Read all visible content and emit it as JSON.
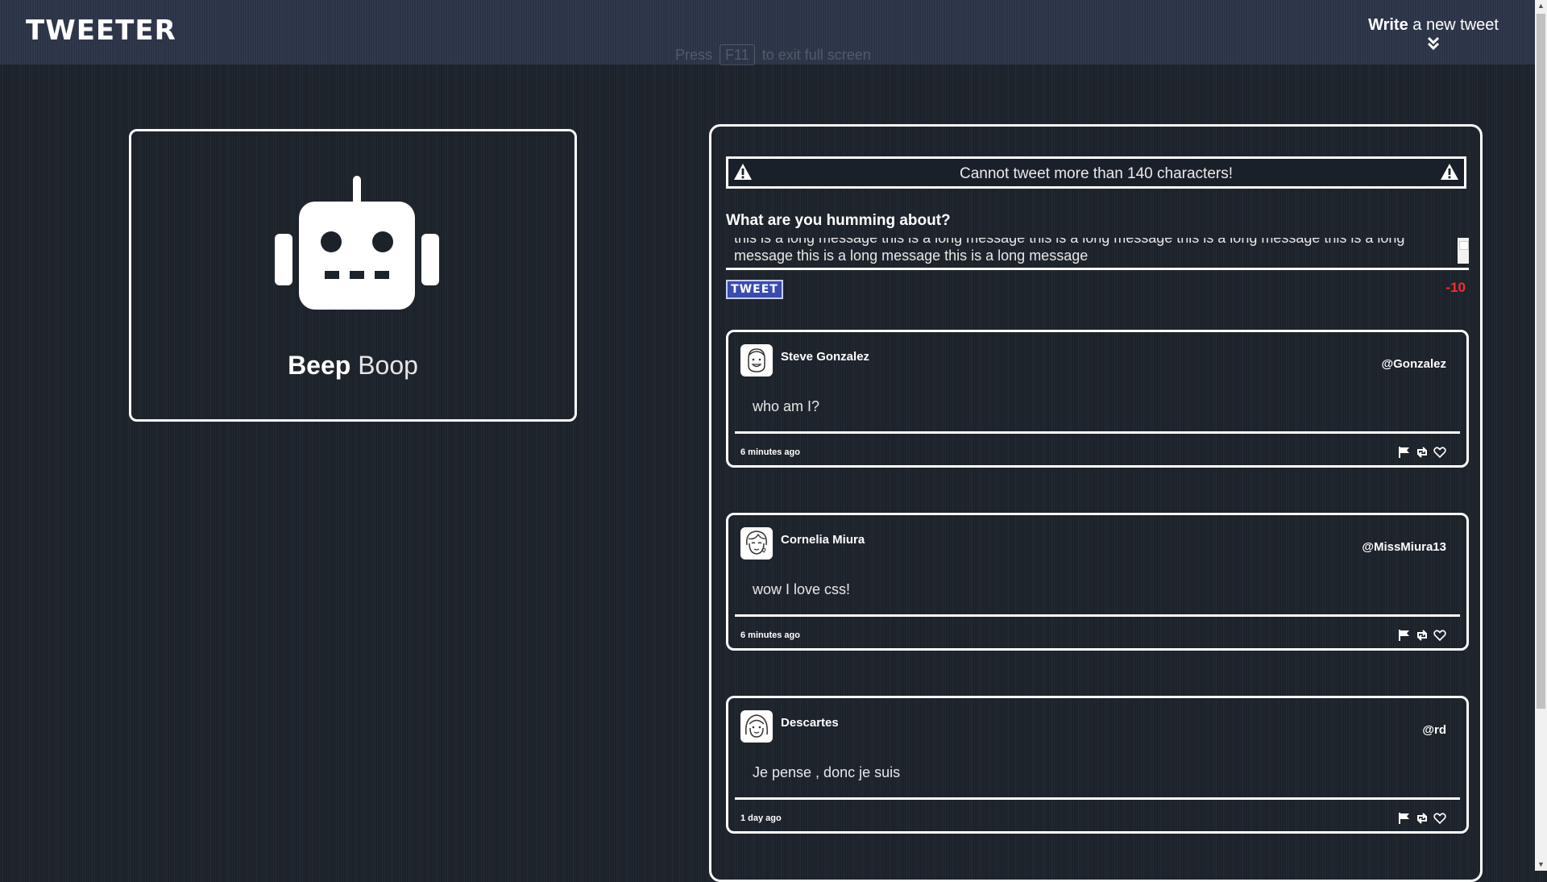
{
  "nav": {
    "logo": "TWEETER",
    "compose_bold": "Write",
    "compose_rest": " a new tweet",
    "fullscreen_hint_pre": "Press",
    "fullscreen_hint_key": "F11",
    "fullscreen_hint_post": "to exit full screen"
  },
  "profile": {
    "first": "Beep",
    "last": "Boop",
    "avatar_icon": "robot-icon"
  },
  "composer": {
    "error": "Cannot tweet more than 140 characters!",
    "prompt": "What are you humming about?",
    "text": "this is a long message   this is a long message   this is a long message   this is a long message   this is a long message   this is a long message   this is a long message",
    "button": "TWEET",
    "counter": "-10"
  },
  "tweets": [
    {
      "name": "Steve Gonzalez",
      "handle": "@Gonzalez",
      "text": "who am I?",
      "time": "6 minutes ago"
    },
    {
      "name": "Cornelia Miura",
      "handle": "@MissMiura13",
      "text": "wow I love css!",
      "time": "6 minutes ago"
    },
    {
      "name": "Descartes",
      "handle": "@rd",
      "text": "Je pense , donc je suis",
      "time": "1 day ago"
    }
  ],
  "colors": {
    "accent": "#3a4bb0",
    "error": "#ff2a2a",
    "nav": "#2b3347",
    "background": "#1c222a"
  }
}
